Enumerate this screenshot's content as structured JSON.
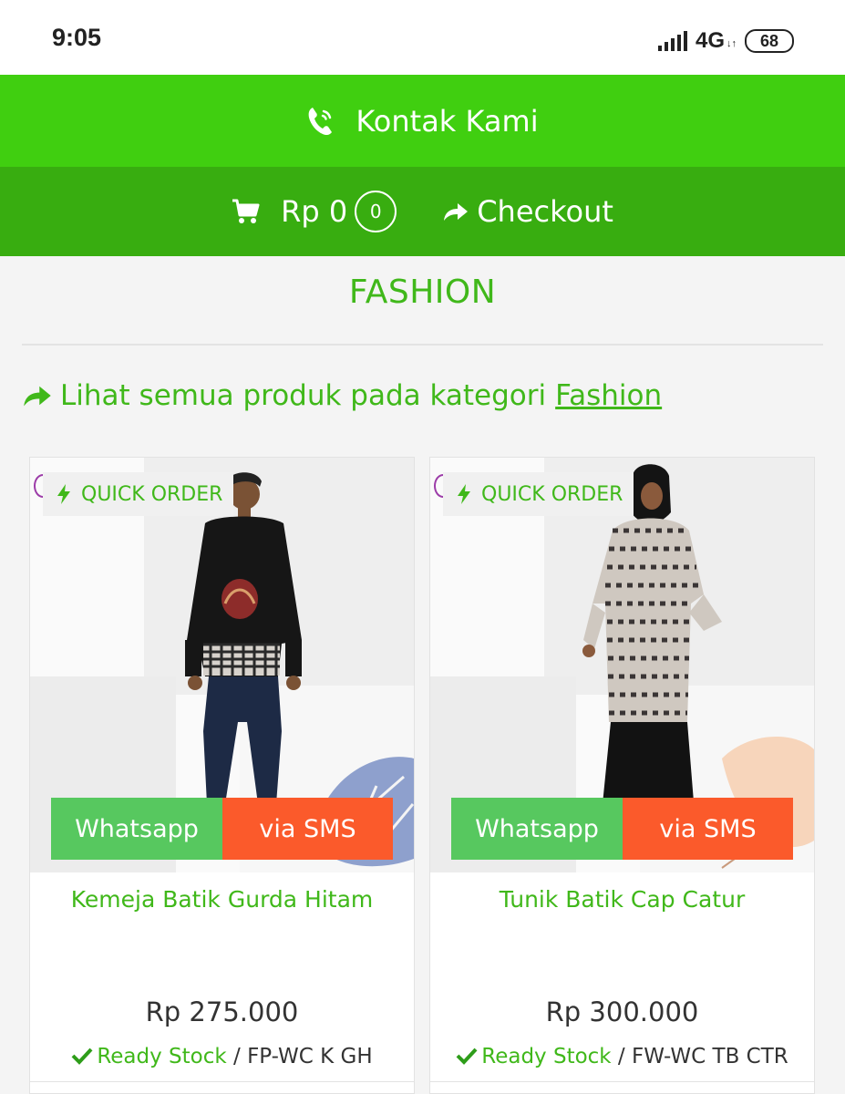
{
  "status_bar": {
    "time": "9:05",
    "network": "4G",
    "network_arrows": "↓↑",
    "battery": "68"
  },
  "header": {
    "contact_label": "Kontak Kami",
    "cart_total": "Rp 0",
    "cart_count": "0",
    "checkout_label": "Checkout"
  },
  "section": {
    "title": "FASHION",
    "see_all_text": "Lihat semua produk pada kategori",
    "see_all_link": "Fashion"
  },
  "products": [
    {
      "badge": "QUICK ORDER",
      "whatsapp_label": "Whatsapp",
      "sms_label": "via SMS",
      "name": "Kemeja Batik Gurda Hitam",
      "price": "Rp 275.000",
      "stock_label": "Ready Stock",
      "sku": " / FP-WC K GH"
    },
    {
      "badge": "QUICK ORDER",
      "whatsapp_label": "Whatsapp",
      "sms_label": "via SMS",
      "name": "Tunik Batik Cap Catur",
      "price": "Rp 300.000",
      "stock_label": "Ready Stock",
      "sku": " / FW-WC TB CTR"
    }
  ],
  "colors": {
    "contact_bar": "#40cf10",
    "cart_bar": "#38ad10",
    "accent_green": "#40b81a",
    "whatsapp": "#57c85f",
    "sms": "#fb5a2b"
  },
  "icons": [
    "phone-icon",
    "cart-icon",
    "share-arrow-icon",
    "bolt-icon",
    "check-icon"
  ]
}
